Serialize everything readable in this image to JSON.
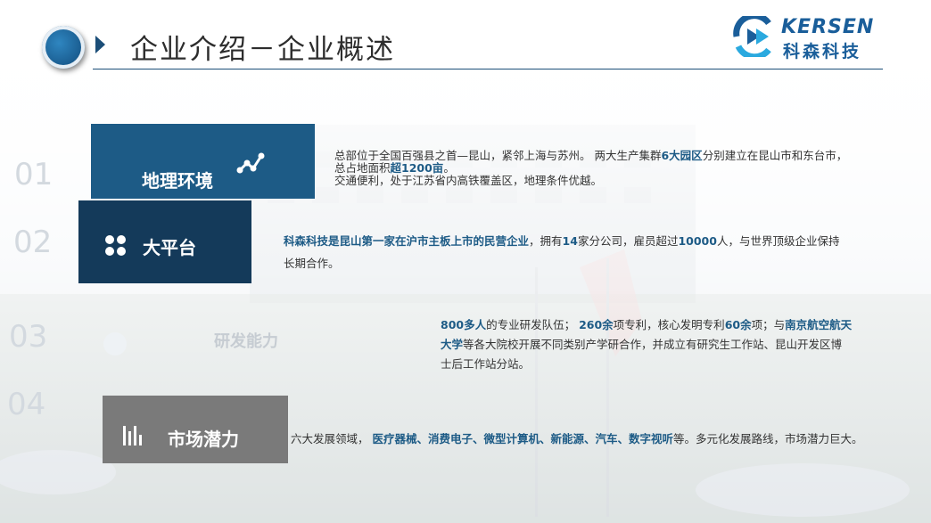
{
  "header": {
    "title": "企业介绍－企业概述",
    "brand_en": "KERSEN",
    "brand_cn": "科森科技"
  },
  "sections": [
    {
      "number": "01",
      "label": "地理环境",
      "icon": "line-chart-icon",
      "desc_line1_a": "总部位于全国百强县之首—昆山，紧邻上海与苏州。  两大生产集群",
      "desc_line1_b": "6大园区",
      "desc_line1_c": "分别建立在昆山市和东台市，",
      "desc_line2_a": "总占地面积",
      "desc_line2_b": "超1200亩",
      "desc_line2_c": "。",
      "desc_line3": " 交通便利，处于江苏省内高铁覆盖区，地理条件优越。"
    },
    {
      "number": "02",
      "label": "大平台",
      "icon": "dots-grid-icon",
      "desc_a": "科森科技是昆山第一家在沪市主板上市的民营企业",
      "desc_b": "，拥有",
      "desc_c": "14",
      "desc_d": "家分公司，雇员超过",
      "desc_e": "10000",
      "desc_f": "人，与世界顶级企业保持",
      "desc_line2": "长期合作。"
    },
    {
      "number": "03",
      "label": "研发能力",
      "icon": "globe-icon",
      "desc_a": "800多人",
      "desc_b": "的专业研发队伍；   ",
      "desc_c": "260余",
      "desc_d": "项专利，核心发明专利",
      "desc_e": "60余",
      "desc_f": "项；与",
      "desc_g": "南京航空航天",
      "desc_h": "大学",
      "desc_i": "等各大院校开展不同类别产学研合作，并成立有研究生工作站、昆山开发区博",
      "desc_line3": "士后工作站分站。"
    },
    {
      "number": "04",
      "label": "市场潜力",
      "icon": "bar-chart-icon",
      "desc_a": "六大发展领域，   ",
      "desc_b": "医疗器械、消费电子、微型计算机、新能源、汽车、数字视听",
      "desc_c": "等。多元化发展路线，市场潜力巨大。"
    }
  ],
  "colors": {
    "primary": "#1d5b86",
    "dark": "#143a5a",
    "grey": "#7a7a7a",
    "brand": "#1a5e9a"
  }
}
